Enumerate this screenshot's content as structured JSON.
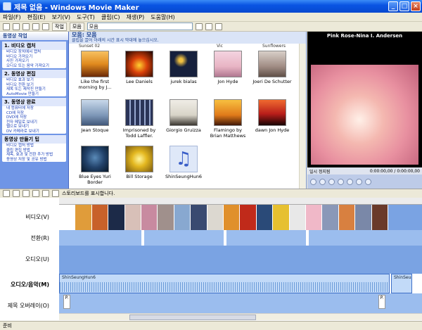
{
  "window": {
    "title": "제목 없음 - Windows Movie Maker",
    "minimize": "_",
    "maximize": "□",
    "close": "×"
  },
  "menu": [
    "파일(F)",
    "편집(E)",
    "보기(V)",
    "도구(T)",
    "클립(C)",
    "재생(P)",
    "도움말(H)"
  ],
  "toolbar": {
    "tasks_label": "작업",
    "collections_label": "모음",
    "collection_value": "모음"
  },
  "tasks": {
    "header": "동영상 작업",
    "sections": [
      {
        "title": "1. 비디오 캡처",
        "links": [
          "비디오 장치에서 캡처",
          "비디오 가져오기",
          "사진 가져오기",
          "오디오 또는 음악 가져오기"
        ]
      },
      {
        "title": "2. 동영상 편집",
        "links": [
          "비디오 효과 보기",
          "비디오 전환 보기",
          "제목 또는 제작진 만들기",
          "AutoMovie 만들기"
        ]
      },
      {
        "title": "3. 동영상 완료",
        "links": [
          "내 컴퓨터에 저장",
          "CD에 저장",
          "DVD에 저장",
          "전자 메일로 보내기",
          "웹으로 보내기",
          "DV 카메라로 보내기"
        ]
      },
      {
        "title": "동영상 만들기 팁",
        "links": [
          "비디오 캡처 방법",
          "클립 편집 방법",
          "제목, 효과 및 전환 추가 방법",
          "동영상 저장 및 공유 방법"
        ]
      }
    ]
  },
  "collection": {
    "title": "모음: 모음",
    "subtitle": "클립을 끌어 아래의 시간 표시 막대에 놓으십시오.",
    "top_row": [
      "Sunset 02",
      "",
      "",
      "Vic",
      "Sunflowers"
    ],
    "items": [
      {
        "caption": "Like the first morning by J...",
        "color": "#e08a1e"
      },
      {
        "caption": "Lee Daniels",
        "color": "#d8400a"
      },
      {
        "caption": "jurek bialas",
        "color": "#16203c"
      },
      {
        "caption": "Jon Hyde",
        "color": "#e8b4c4"
      },
      {
        "caption": "Joeri De Schutter",
        "color": "#a08c84"
      },
      {
        "caption": "Jean Stoque",
        "color": "#7e98b8"
      },
      {
        "caption": "Imprisoned by Todd Laffler.",
        "color": "#2a3458"
      },
      {
        "caption": "Giorgio Gruizza",
        "color": "#d8d4c8"
      },
      {
        "caption": "Flamingo by Brian Matthews",
        "color": "#e07a1a"
      },
      {
        "caption": "dawn Jon Hyde",
        "color": "#b81e1a"
      },
      {
        "caption": "Blue Eyes Yuri Border",
        "color": "#22426a"
      },
      {
        "caption": "Bill Storage",
        "color": "#e4b820"
      },
      {
        "caption": "ShinSeungHun6",
        "color": "#dfe8f8"
      }
    ]
  },
  "monitor": {
    "title": "Pink Rose-Nina I. Andersen",
    "status": "일시 정지됨",
    "time": "0:00:00,00 / 0:00:00,00"
  },
  "storyboard": {
    "label": "스토리보드를 표시합니다."
  },
  "timeline": {
    "tracks": {
      "video": "비디오(V)",
      "transition": "전환(R)",
      "audio": "오디오(U)",
      "audio_music": "오디오/음악(M)",
      "title_overlay": "제목 오버레이(O)"
    },
    "audio_clip_label": "ShinSeungHun6",
    "title_clip_label": "P.",
    "video_clip_colors": [
      "#ffffff",
      "#e09c3a",
      "#c8612a",
      "#1c2a48",
      "#d8c0b8",
      "#c88aa0",
      "#a0908c",
      "#88a8d0",
      "#3a4a70",
      "#dcd8d0",
      "#e0902c",
      "#c02a1a",
      "#2a4a78",
      "#e6c030",
      "#e8e8e8",
      "#f0b8c8",
      "#8a98b8",
      "#d88040",
      "#7a88a8",
      "#6a3a2a"
    ]
  },
  "status": {
    "text": "준비"
  }
}
